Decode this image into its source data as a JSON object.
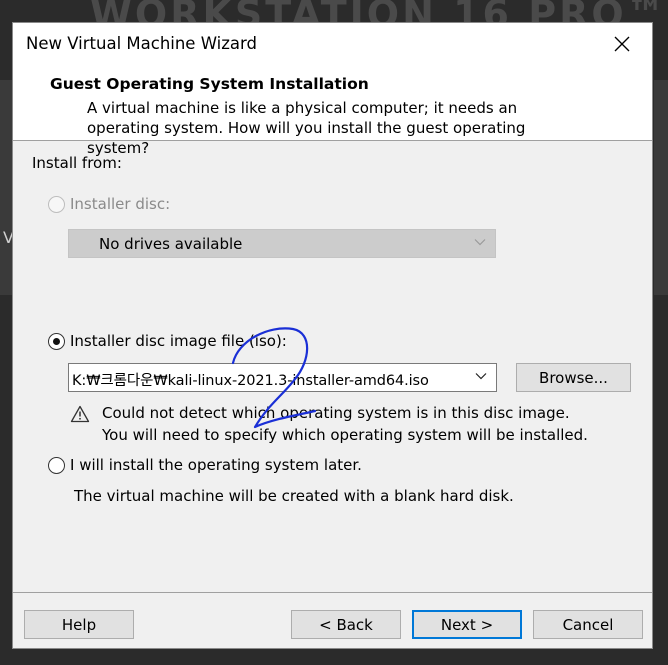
{
  "background": {
    "banner_text": "WORKSTATION 16 PRO™",
    "side_letter": "V"
  },
  "window": {
    "title": "New Virtual Machine Wizard"
  },
  "header": {
    "title": "Guest Operating System Installation",
    "description": "A virtual machine is like a physical computer; it needs an operating system. How will you install the guest operating system?"
  },
  "install": {
    "from_label": "Install from:",
    "disc": {
      "label": "Installer disc:",
      "selected": false,
      "enabled": false,
      "drive_value": "No drives available"
    },
    "image": {
      "label": "Installer disc image file (iso):",
      "selected": true,
      "path_value": "K:₩크롬다운₩kali-linux-2021.3-installer-amd64.iso",
      "browse_label": "Browse...",
      "warning_line1": "Could not detect which operating system is in this disc image.",
      "warning_line2": "You will need to specify which operating system will be installed."
    },
    "later": {
      "label": "I will install the operating system later.",
      "selected": false,
      "description": "The virtual machine will be created with a blank hard disk."
    }
  },
  "footer": {
    "help_label": "Help",
    "back_label": "< Back",
    "next_label": "Next >",
    "cancel_label": "Cancel"
  },
  "colors": {
    "accent": "#0078d7",
    "annotation_ink": "#1a2fd6"
  },
  "icons": {
    "close": "close-icon",
    "warning": "warning-icon",
    "dropdown": "chevron-down-icon"
  }
}
